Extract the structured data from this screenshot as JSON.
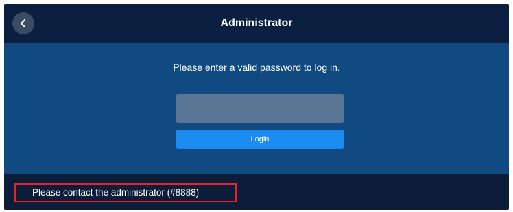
{
  "header": {
    "title": "Administrator",
    "back_icon": "chevron-left-icon"
  },
  "login": {
    "prompt": "Please enter a valid password to log in.",
    "password_value": "",
    "login_label": "Login"
  },
  "footer": {
    "note": "Please contact the administrator (#8888)",
    "highlight_color": "#e5222e"
  },
  "colors": {
    "header_bg": "#0b2041",
    "panel_bg": "#104a80",
    "input_bg": "#5b7694",
    "button_bg": "#1c8cf0",
    "footer_bg": "#0b1d38"
  }
}
